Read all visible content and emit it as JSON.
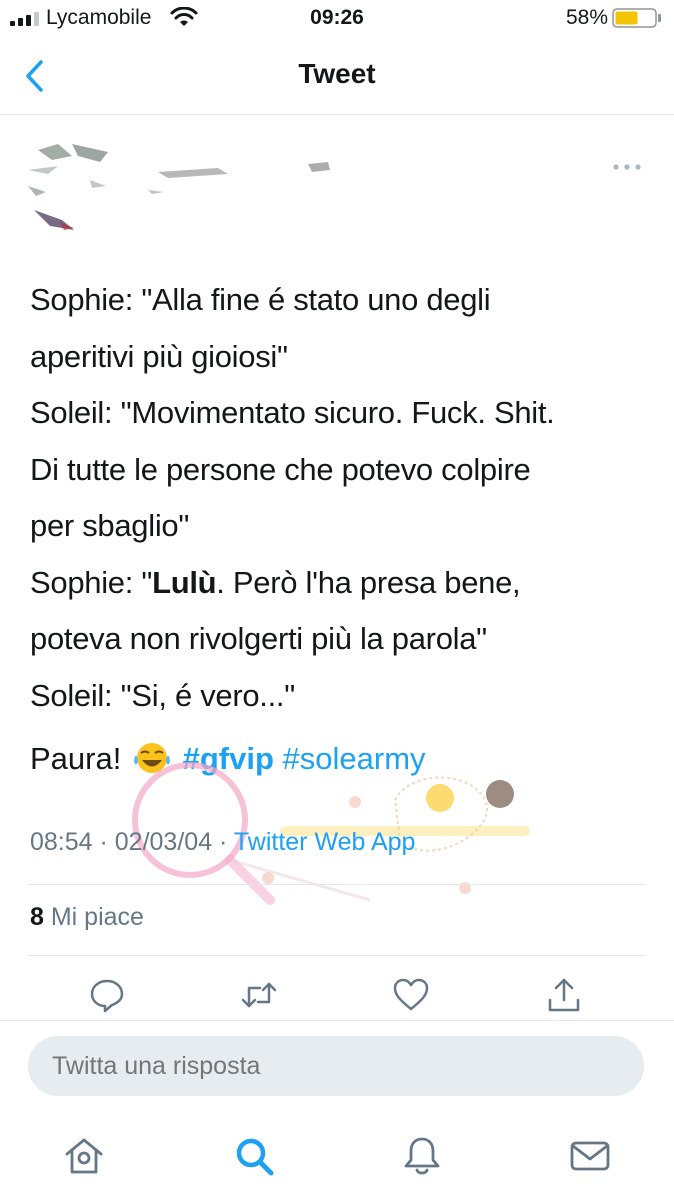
{
  "status_bar": {
    "carrier": "Lycamobile",
    "time": "09:26",
    "battery_percent": "58%",
    "battery_level": 0.58,
    "battery_color": "#f5c400"
  },
  "nav": {
    "title": "Tweet",
    "back_icon": "chevron-left-icon"
  },
  "tweet": {
    "author_hidden": true,
    "lines": [
      {
        "text": "Sophie: \"Alla fine é stato uno degli"
      },
      {
        "text": "aperitivi più gioiosi\""
      },
      {
        "text": "Soleil: \"Movimentato sicuro. Fuck. Shit."
      },
      {
        "text": "Di tutte le persone che potevo colpire"
      },
      {
        "text": "per sbaglio\""
      },
      {
        "prefix": "Sophie: \"",
        "bold": "Lulù",
        "suffix": ". Però l'ha presa bene,"
      },
      {
        "text": "poteva non rivolgerti più la parola\""
      },
      {
        "text": "Soleil: \"Si, é vero...\""
      }
    ],
    "closing": {
      "text": "Paura!",
      "emoji": "tears-of-joy-emoji",
      "hashtags": [
        "#gfvip",
        "#solearmy"
      ]
    },
    "timestamp": "08:54 · 02/03/04",
    "source": "Twitter Web App",
    "likes_count": "8",
    "likes_label": "Mi piace"
  },
  "actions": [
    {
      "name": "reply-icon"
    },
    {
      "name": "retweet-icon"
    },
    {
      "name": "like-icon"
    },
    {
      "name": "share-icon"
    }
  ],
  "reply": {
    "placeholder": "Twitta una risposta"
  },
  "tab_bar": [
    {
      "name": "home-icon"
    },
    {
      "name": "search-icon",
      "active": true
    },
    {
      "name": "notifications-icon"
    },
    {
      "name": "messages-icon"
    }
  ],
  "colors": {
    "accent": "#1da1f2",
    "text": "#14171a",
    "muted": "#657786",
    "divider": "#e1e8ed"
  }
}
